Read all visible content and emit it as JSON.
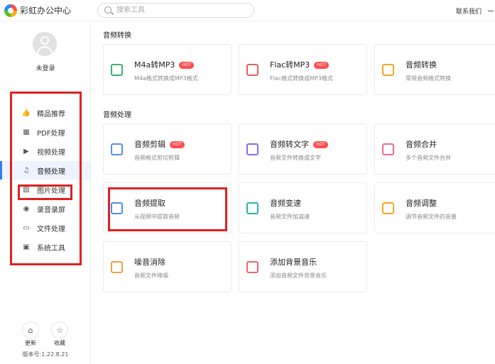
{
  "app": {
    "title": "彩虹办公中心"
  },
  "search": {
    "placeholder": "搜索工具"
  },
  "header": {
    "contact": "联系我们"
  },
  "user": {
    "status": "未登录"
  },
  "sidebar": {
    "items": [
      {
        "label": "精品推荐",
        "icon": "thumbs-up-icon",
        "glyph": "👍"
      },
      {
        "label": "PDF处理",
        "icon": "pdf-icon",
        "glyph": "▦"
      },
      {
        "label": "视频处理",
        "icon": "video-icon",
        "glyph": "▶"
      },
      {
        "label": "音频处理",
        "icon": "music-note-icon",
        "glyph": "♫",
        "active": true
      },
      {
        "label": "图片处理",
        "icon": "image-icon",
        "glyph": "▨"
      },
      {
        "label": "录音录屏",
        "icon": "microphone-icon",
        "glyph": "◉"
      },
      {
        "label": "文件处理",
        "icon": "folder-icon",
        "glyph": "▭"
      },
      {
        "label": "系统工具",
        "icon": "monitor-icon",
        "glyph": "▣"
      }
    ],
    "update_label": "更新",
    "favorite_label": "收藏",
    "version": "版本号:1.22.8.21"
  },
  "sections": [
    {
      "title": "音频转换",
      "cards": [
        {
          "title": "M4a转MP3",
          "hot": "HOT",
          "desc": "M4a格式转换成MP3格式",
          "icon": "m4a-icon",
          "color": "#3bb273"
        },
        {
          "title": "Flac转MP3",
          "hot": "HOT",
          "desc": "Flac格式转换成MP3格式",
          "icon": "flac-icon",
          "color": "#e85c5c"
        },
        {
          "title": "音频转换",
          "hot": "",
          "desc": "常规音频格式转换",
          "icon": "audio-convert-icon",
          "color": "#f5a623"
        }
      ]
    },
    {
      "title": "音频处理",
      "cards": [
        {
          "title": "音频剪辑",
          "hot": "HOT",
          "desc": "音频格式剪切剪辑",
          "icon": "crop-icon",
          "color": "#5b8def"
        },
        {
          "title": "音频转文字",
          "hot": "HOT",
          "desc": "音频文件转换成文字",
          "icon": "text-icon",
          "color": "#8a6de9"
        },
        {
          "title": "音频合并",
          "hot": "",
          "desc": "多个音频文件合并",
          "icon": "merge-icon",
          "color": "#ef6a8a"
        },
        {
          "title": "音频提取",
          "hot": "",
          "desc": "从视频中提取音频",
          "icon": "extract-icon",
          "color": "#4a90e2"
        },
        {
          "title": "音频变速",
          "hot": "",
          "desc": "音频文件加减速",
          "icon": "speed-icon",
          "color": "#2bb5a0"
        },
        {
          "title": "音频调整",
          "hot": "",
          "desc": "调节音频文件的音量",
          "icon": "volume-icon",
          "color": "#f5a623"
        },
        {
          "title": "噪音消除",
          "hot": "",
          "desc": "音频文件降噪",
          "icon": "noise-icon",
          "color": "#f0a040"
        },
        {
          "title": "添加背景音乐",
          "hot": "",
          "desc": "添加音频文件背景音乐",
          "icon": "bgm-icon",
          "color": "#e86a6a"
        }
      ]
    }
  ]
}
